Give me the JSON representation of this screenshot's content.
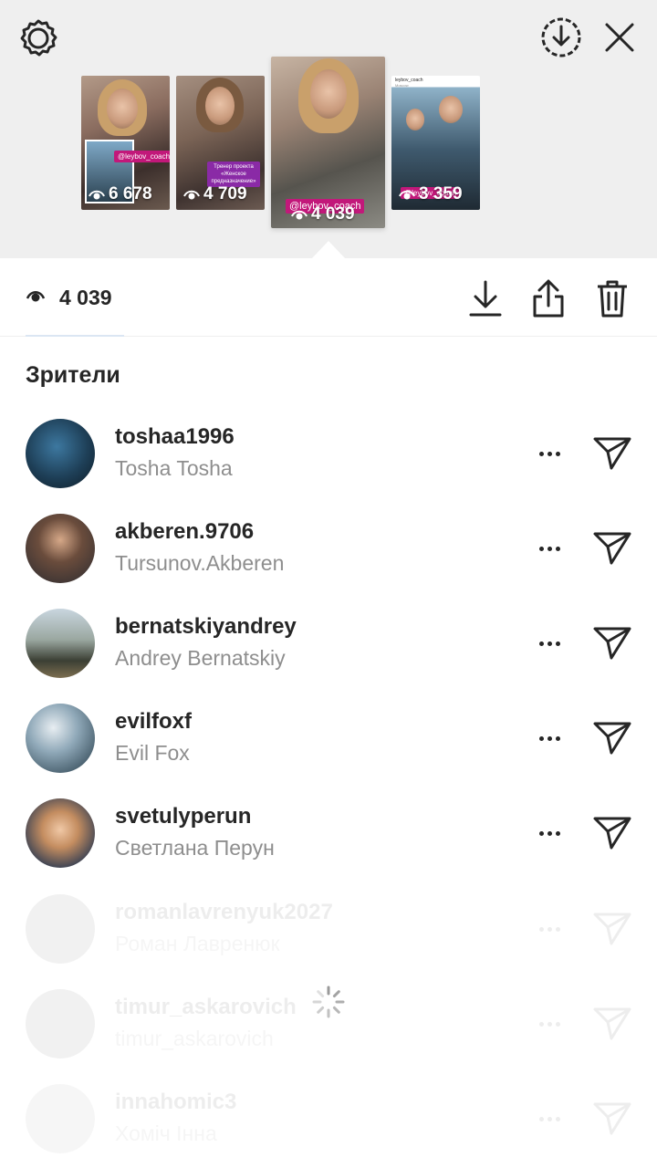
{
  "header": {
    "settings_icon": "gear-icon",
    "download_all_icon": "download-circle-icon",
    "close_icon": "close-icon"
  },
  "stories": [
    {
      "views": "6 678",
      "tag": "@leybov_coach"
    },
    {
      "views": "4 709",
      "tag": "Тренер проекта «Женское предназначение»"
    },
    {
      "views": "4 039",
      "tag": "@leybov_coach"
    },
    {
      "views": "3 359",
      "tag": "@leybov_coach",
      "header_name": "leybov_coach",
      "header_sub": "Moscow"
    }
  ],
  "stats": {
    "views": "4 039",
    "download_icon": "download-icon",
    "share_icon": "share-icon",
    "delete_icon": "trash-icon"
  },
  "viewers_title": "Зрители",
  "viewers": [
    {
      "username": "toshaa1996",
      "fullname": "Tosha Tosha"
    },
    {
      "username": "akberen.9706",
      "fullname": "Tursunov.Akberen"
    },
    {
      "username": "bernatskiyandrey",
      "fullname": "Andrey Bernatskiy"
    },
    {
      "username": "evilfoxf",
      "fullname": "Evil Fox"
    },
    {
      "username": "svetulyperun",
      "fullname": "Светлана Перун"
    },
    {
      "username": "romanlavrenyuk2027",
      "fullname": "Роман Лавренюк"
    },
    {
      "username": "timur_askarovich",
      "fullname": "timur_askarovich"
    },
    {
      "username": "innahomic3",
      "fullname": "Хоміч Інна"
    }
  ],
  "colors": {
    "top_background": "#efefef",
    "story_tag": "#c2187a",
    "secondary_text": "#8e8e8e",
    "primary_text": "#262626"
  }
}
